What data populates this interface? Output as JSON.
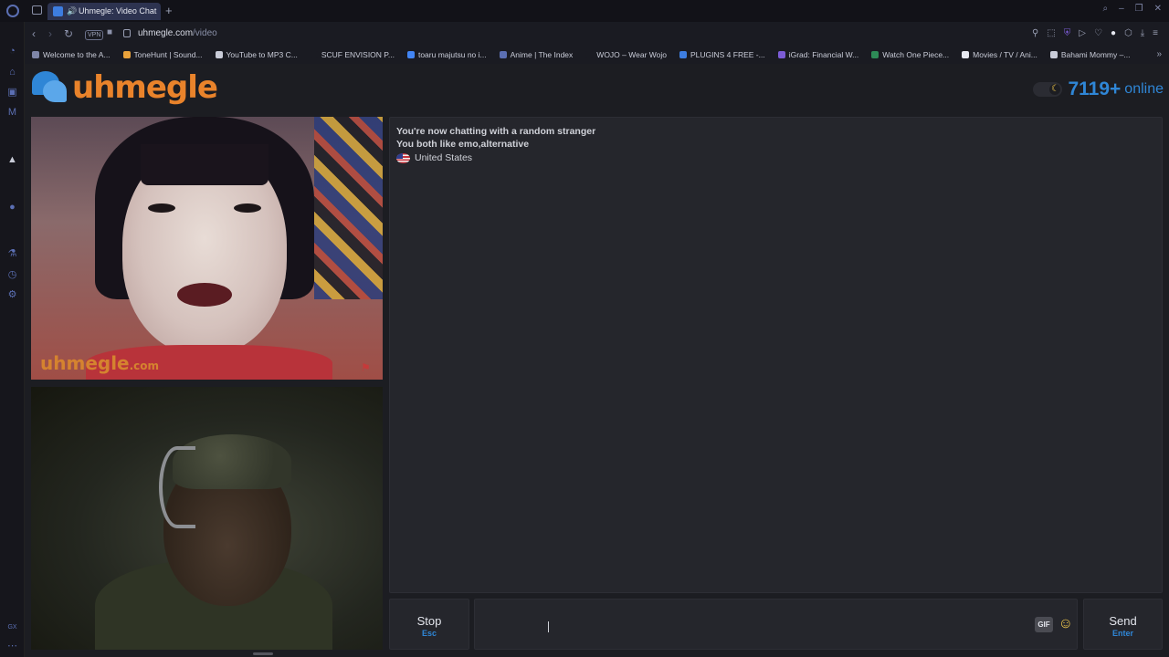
{
  "browser": {
    "tab_title": "Uhmegle: Video Chat",
    "new_tab_symbol": "+",
    "vpn_label": "VPN",
    "url_host": "uhmegle.com",
    "url_path": "/video",
    "bookmarks": [
      {
        "label": "Welcome to the A...",
        "color": "#7f86a8"
      },
      {
        "label": "ToneHunt | Sound...",
        "color": "#e9a23b"
      },
      {
        "label": "YouTube to MP3 C...",
        "color": "#c9ccd8"
      },
      {
        "label": "SCUF ENVISION P...",
        "color": "#1a1b22"
      },
      {
        "label": "toaru majutsu no i...",
        "color": "#4285f4"
      },
      {
        "label": "Anime | The Index",
        "color": "#5b6fb3"
      },
      {
        "label": "WOJO – Wear Wojo",
        "color": "#1a1b22"
      },
      {
        "label": "PLUGINS 4 FREE -...",
        "color": "#3d7de0"
      },
      {
        "label": "iGrad: Financial W...",
        "color": "#7c5cd6"
      },
      {
        "label": "Watch One Piece...",
        "color": "#2e8b57"
      },
      {
        "label": "Movies / TV / Ani...",
        "color": "#e6e8f0"
      },
      {
        "label": "Bahami Mommy –...",
        "color": "#c9ccd8"
      }
    ]
  },
  "site": {
    "logo_text": "uhmegle",
    "online_count": "7119+",
    "online_label": "online",
    "watermark_main": "uhmegle",
    "watermark_suffix": ".com"
  },
  "chat": {
    "lines": [
      "You're now chatting with a random stranger",
      "You both like emo,alternative"
    ],
    "country": "United States"
  },
  "controls": {
    "stop_label": "Stop",
    "stop_key": "Esc",
    "send_label": "Send",
    "send_key": "Enter",
    "gif_label": "GIF",
    "message_value": ""
  },
  "colors": {
    "accent_blue": "#2f86d6",
    "logo_orange": "#e9832b",
    "background": "#1c1d22",
    "panel": "#25262c"
  }
}
